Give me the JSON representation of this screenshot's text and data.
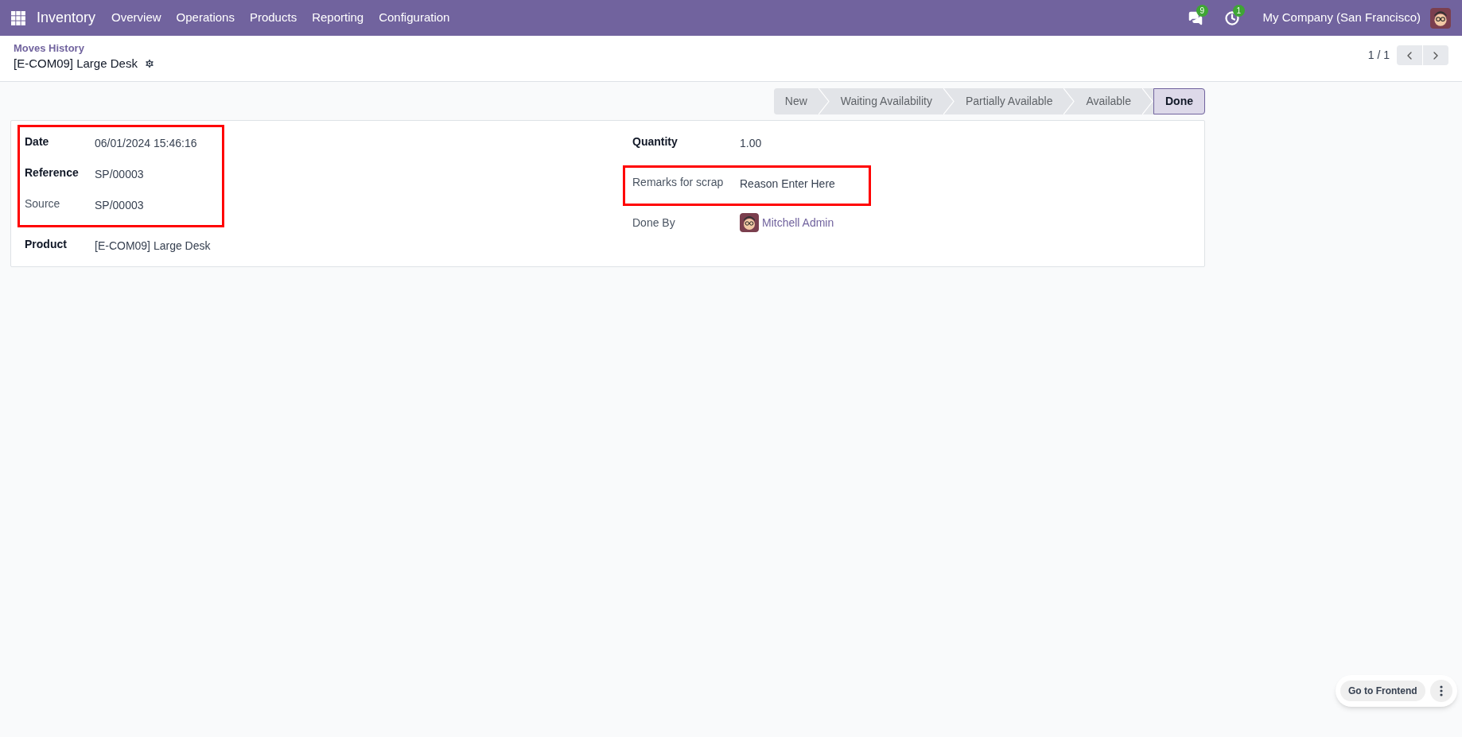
{
  "navbar": {
    "app": "Inventory",
    "menu": [
      "Overview",
      "Operations",
      "Products",
      "Reporting",
      "Configuration"
    ],
    "messages_badge": "9",
    "activities_badge": "1",
    "company": "My Company (San Francisco)"
  },
  "breadcrumb": {
    "parent": "Moves History",
    "current": "[E-COM09] Large Desk"
  },
  "pager": {
    "text": "1 / 1"
  },
  "stages": [
    {
      "label": "New",
      "selected": false
    },
    {
      "label": "Waiting Availability",
      "selected": false
    },
    {
      "label": "Partially Available",
      "selected": false
    },
    {
      "label": "Available",
      "selected": false
    },
    {
      "label": "Done",
      "selected": true
    }
  ],
  "form": {
    "left": [
      {
        "highlighted": true,
        "fields": [
          {
            "label": "Date",
            "value": "06/01/2024 15:46:16",
            "bold": true,
            "kind": "text"
          },
          {
            "label": "Reference",
            "value": "SP/00003",
            "bold": true,
            "kind": "text"
          },
          {
            "label": "Source",
            "value": "SP/00003",
            "bold": false,
            "kind": "text"
          }
        ]
      },
      {
        "highlighted": false,
        "fields": [
          {
            "label": "Product",
            "value": "[E-COM09] Large Desk",
            "bold": true,
            "kind": "text"
          }
        ]
      }
    ],
    "right": [
      {
        "highlighted": false,
        "fields": [
          {
            "label": "Quantity",
            "value": "1.00",
            "bold": true,
            "kind": "text"
          }
        ]
      },
      {
        "highlighted": true,
        "fields": [
          {
            "label": "Remarks for scrap",
            "value": "Reason Enter Here",
            "bold": false,
            "kind": "text"
          }
        ]
      },
      {
        "highlighted": false,
        "fields": [
          {
            "label": "Done By",
            "value": "Mitchell Admin",
            "bold": false,
            "kind": "user"
          }
        ]
      }
    ]
  },
  "frontend_button": "Go to Frontend"
}
